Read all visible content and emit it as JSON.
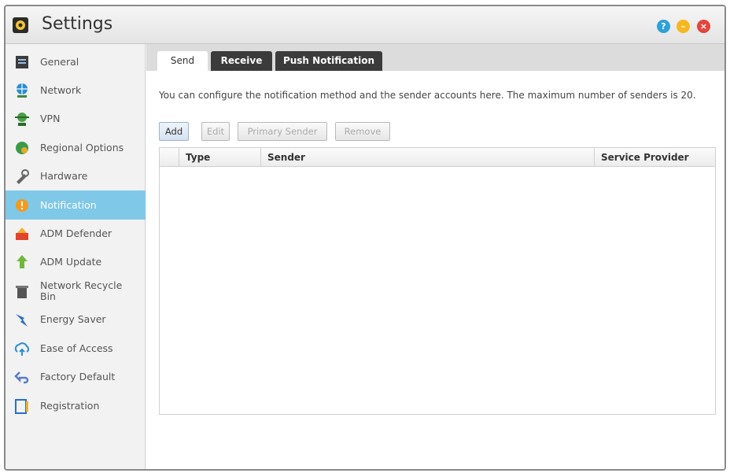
{
  "window": {
    "title": "Settings",
    "help_glyph": "?",
    "min_glyph": "–",
    "close_glyph": "×"
  },
  "sidebar": {
    "items": [
      {
        "label": "General",
        "icon": "general-icon"
      },
      {
        "label": "Network",
        "icon": "network-icon"
      },
      {
        "label": "VPN",
        "icon": "vpn-icon"
      },
      {
        "label": "Regional Options",
        "icon": "regional-options-icon"
      },
      {
        "label": "Hardware",
        "icon": "hardware-icon"
      },
      {
        "label": "Notification",
        "icon": "notification-icon",
        "active": true
      },
      {
        "label": "ADM Defender",
        "icon": "adm-defender-icon"
      },
      {
        "label": "ADM Update",
        "icon": "adm-update-icon"
      },
      {
        "label": "Network Recycle Bin",
        "icon": "recycle-bin-icon"
      },
      {
        "label": "Energy Saver",
        "icon": "energy-saver-icon"
      },
      {
        "label": "Ease of Access",
        "icon": "ease-of-access-icon"
      },
      {
        "label": "Factory Default",
        "icon": "factory-default-icon"
      },
      {
        "label": "Registration",
        "icon": "registration-icon"
      }
    ]
  },
  "tabs": [
    {
      "label": "Send",
      "active": true
    },
    {
      "label": "Receive"
    },
    {
      "label": "Push Notification"
    }
  ],
  "main": {
    "description": "You can configure the notification method and the sender accounts here. The maximum number of senders is 20.",
    "buttons": {
      "add": "Add",
      "edit": "Edit",
      "primary_sender": "Primary Sender",
      "remove": "Remove"
    },
    "table": {
      "columns": [
        "Type",
        "Sender",
        "Service Provider"
      ],
      "rows": []
    }
  },
  "colors": {
    "active_item": "#7fc8e8",
    "help_button": "#2fa0d8",
    "minimize_button": "#f6b821",
    "close_button": "#e2463c",
    "dark_tab": "#3b3b3b"
  }
}
